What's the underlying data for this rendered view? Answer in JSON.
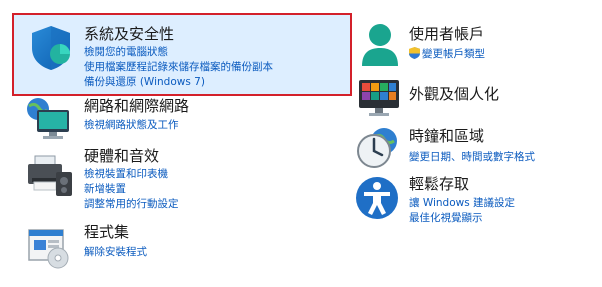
{
  "left": [
    {
      "id": "system-security",
      "title": "系統及安全性",
      "links": [
        "檢閱您的電腦狀態",
        "使用檔案歷程記錄來儲存檔案的備份副本",
        "備份與還原 (Windows 7)"
      ]
    },
    {
      "id": "network",
      "title": "網路和網際網路",
      "links": [
        "檢視網路狀態及工作"
      ]
    },
    {
      "id": "hardware",
      "title": "硬體和音效",
      "links": [
        "檢視裝置和印表機",
        "新增裝置",
        "調整常用的行動設定"
      ]
    },
    {
      "id": "programs",
      "title": "程式集",
      "links": [
        "解除安裝程式"
      ]
    }
  ],
  "right": [
    {
      "id": "user-accounts",
      "title": "使用者帳戶",
      "links": [
        "變更帳戶類型"
      ]
    },
    {
      "id": "appearance",
      "title": "外觀及個人化",
      "links": []
    },
    {
      "id": "clock-region",
      "title": "時鐘和區域",
      "links": [
        "變更日期、時間或數字格式"
      ]
    },
    {
      "id": "ease-of-access",
      "title": "輕鬆存取",
      "links": [
        "讓 Windows 建議設定",
        "最佳化視覺顯示"
      ]
    }
  ],
  "colors": {
    "link": "#0b5bbf",
    "title": "#1a1a1a",
    "highlight_border": "#d3202a",
    "highlight_fill": "#ddeeff"
  },
  "icons": {
    "system-security": "shield-icon",
    "network": "network-globe-icon",
    "hardware": "printer-speaker-icon",
    "programs": "programs-box-icon",
    "user-accounts": "user-icon",
    "appearance": "monitor-colors-icon",
    "clock-region": "clock-globe-icon",
    "ease-of-access": "accessibility-icon",
    "uac": "uac-shield-icon"
  }
}
